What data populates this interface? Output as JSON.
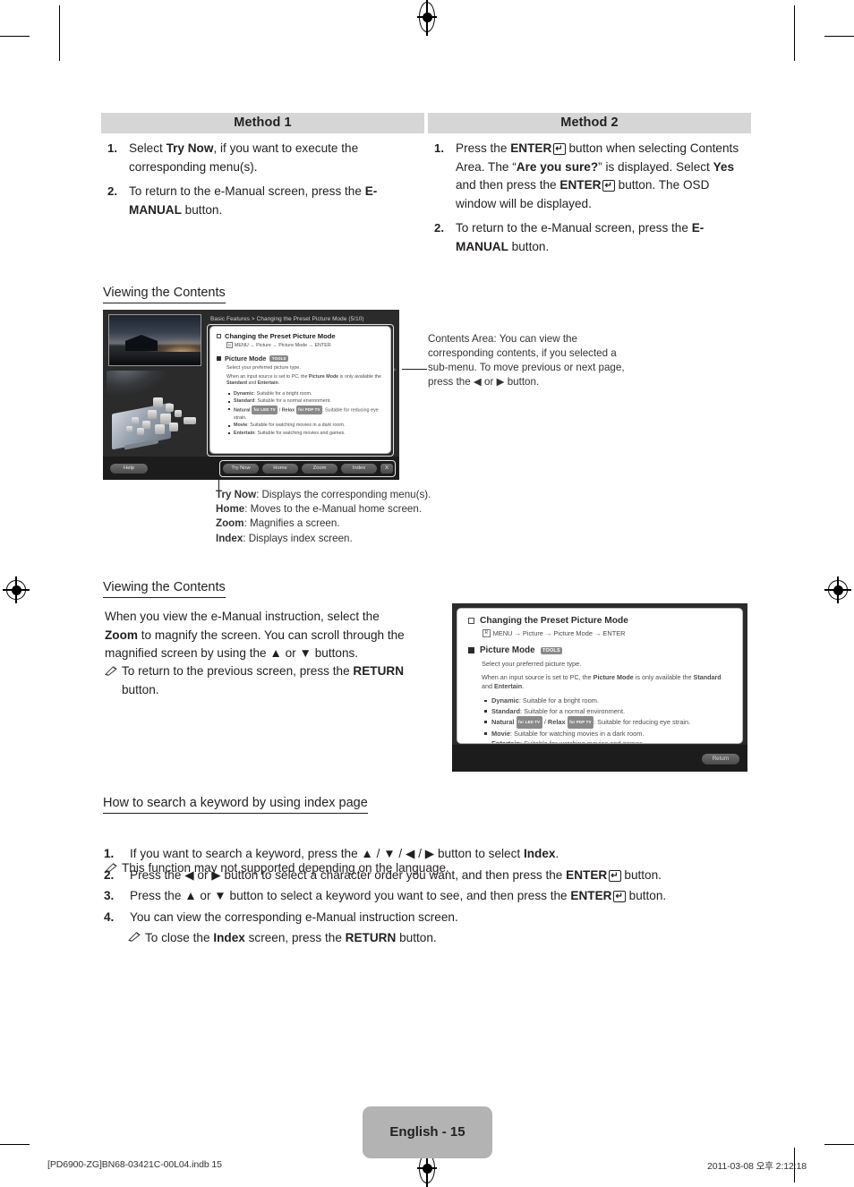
{
  "methods": {
    "columns": [
      {
        "header": "Method 1",
        "steps": [
          "Select <b>Try Now</b>, if you want to execute the corresponding menu(s).",
          "To return to the e-Manual screen, press the <b>E-MANUAL</b> button."
        ]
      },
      {
        "header": "Method 2",
        "steps": [
          "Press the <b>ENTER</b><span class=\"k-enter\">&#x21B5;</span> button when selecting Contents Area. The “<b>Are you sure?</b>” is displayed. Select <b>Yes</b> and then press the <b>ENTER</b><span class=\"k-enter\">&#x21B5;</span> button. The OSD window will be displayed.",
          "To return to the e-Manual screen, press the <b>E-MANUAL</b> button."
        ]
      }
    ]
  },
  "section1": {
    "heading": "Viewing the Contents",
    "callout": "Contents Area: You can view the corresponding contents, if you selected a sub-menu. To move previous or next page, press the ◀ or ▶ button.",
    "legend": [
      {
        "key": "Try Now",
        "desc": ": Displays the corresponding menu(s)."
      },
      {
        "key": "Home",
        "desc": ": Moves to the e-Manual home screen."
      },
      {
        "key": "Zoom",
        "desc": ": Magnifies a screen."
      },
      {
        "key": "Index",
        "desc": ": Displays index screen."
      }
    ]
  },
  "emanual_screenshot": {
    "breadcrumb": "Basic Features > Changing the Preset Picture Mode (5/10)",
    "title": "Changing the Preset Picture Mode",
    "path": "MENU → Picture → Picture Mode → ENTER",
    "menu_badge": "m",
    "subtitle": "Picture Mode",
    "tools_badge": "TOOLS",
    "intro": "Select your preferred picture type.",
    "note": "When an input source is set to PC, the <b>Picture Mode</b> is only available the <b>Standard</b> and <b>Entertain</b>.",
    "bullets": [
      "<b>Dynamic</b>: Suitable for a bright room.",
      "<b>Standard</b>: Suitable for a normal environment.",
      "<b>Natural</b> <span class=\"badge\">for LED TV</span> / <b>Relax</b> <span class=\"badge\">for PDP TV</span>: Suitable for reducing eye strain.",
      "<b>Movie</b>: Suitable for watching movies in a dark room.",
      "<b>Entertain</b>: Suitable for watching movies and games."
    ],
    "buttons": {
      "help": "Help",
      "try_now": "Try Now",
      "home": "Home",
      "zoom": "Zoom",
      "index": "Index",
      "close": "X"
    }
  },
  "section2": {
    "heading": "Viewing the Contents",
    "paragraph": "When you view the e-Manual instruction, select the <b>Zoom</b> to magnify the screen. You can scroll through the magnified screen by using the ▲ or ▼ buttons.",
    "note": "To return to the previous screen, press the <b>RETURN</b> button."
  },
  "zoom_screenshot": {
    "title": "Changing the Preset Picture Mode",
    "path": "MENU → Picture → Picture Mode → ENTER",
    "subtitle": "Picture Mode",
    "tools_badge": "TOOLS",
    "intro": "Select your preferred picture type.",
    "note": "When an input source is set to PC, the <b>Picture Mode</b> is only available the <b>Standard</b> and <b>Entertain</b>.",
    "bullets": [
      "<b>Dynamic</b>: Suitable for a bright room.",
      "<b>Standard</b>: Suitable for a normal environment.",
      "<b>Natural</b> <span class=\"badge\">for LED TV</span> / <b>Relax</b> <span class=\"badge\">for PDP TV</span>: Suitable for reducing eye strain.",
      "<b>Movie</b>: Suitable for watching movies in a dark room.",
      "<b>Entertain</b>: Suitable for watching movies and games."
    ],
    "return_button": "Return"
  },
  "section3": {
    "heading": "How to search a keyword by using index page",
    "note": "This function may not supported depending on the language.",
    "steps": [
      "If you want to search a keyword, press the ▲ / ▼ / ◀ / ▶ button to select <b>Index</b>.",
      "Press the ◀ or ▶ button to select a character order you want, and then press the <b>ENTER</b><span class=\"k-enter\">&#x21B5;</span> button.",
      "Press the ▲ or ▼ button to select a keyword you want to see, and then press the <b>ENTER</b><span class=\"k-enter\">&#x21B5;</span> button.",
      "You can view the corresponding e-Manual instruction screen."
    ],
    "substep": "To close the <b>Index</b> screen, press the <b>RETURN</b> button."
  },
  "footer": {
    "page_label": "English - 15",
    "file_info": "[PD6900-ZG]BN68-03421C-00L04.indb   15",
    "timestamp": "2011-03-08   오후 2:12:18"
  },
  "colors": {
    "header_gray": "#d6d6d6",
    "page_tab_gray": "#b3b3b3",
    "screenshot_dark": "#2b2b2b",
    "text": "#231f20"
  }
}
